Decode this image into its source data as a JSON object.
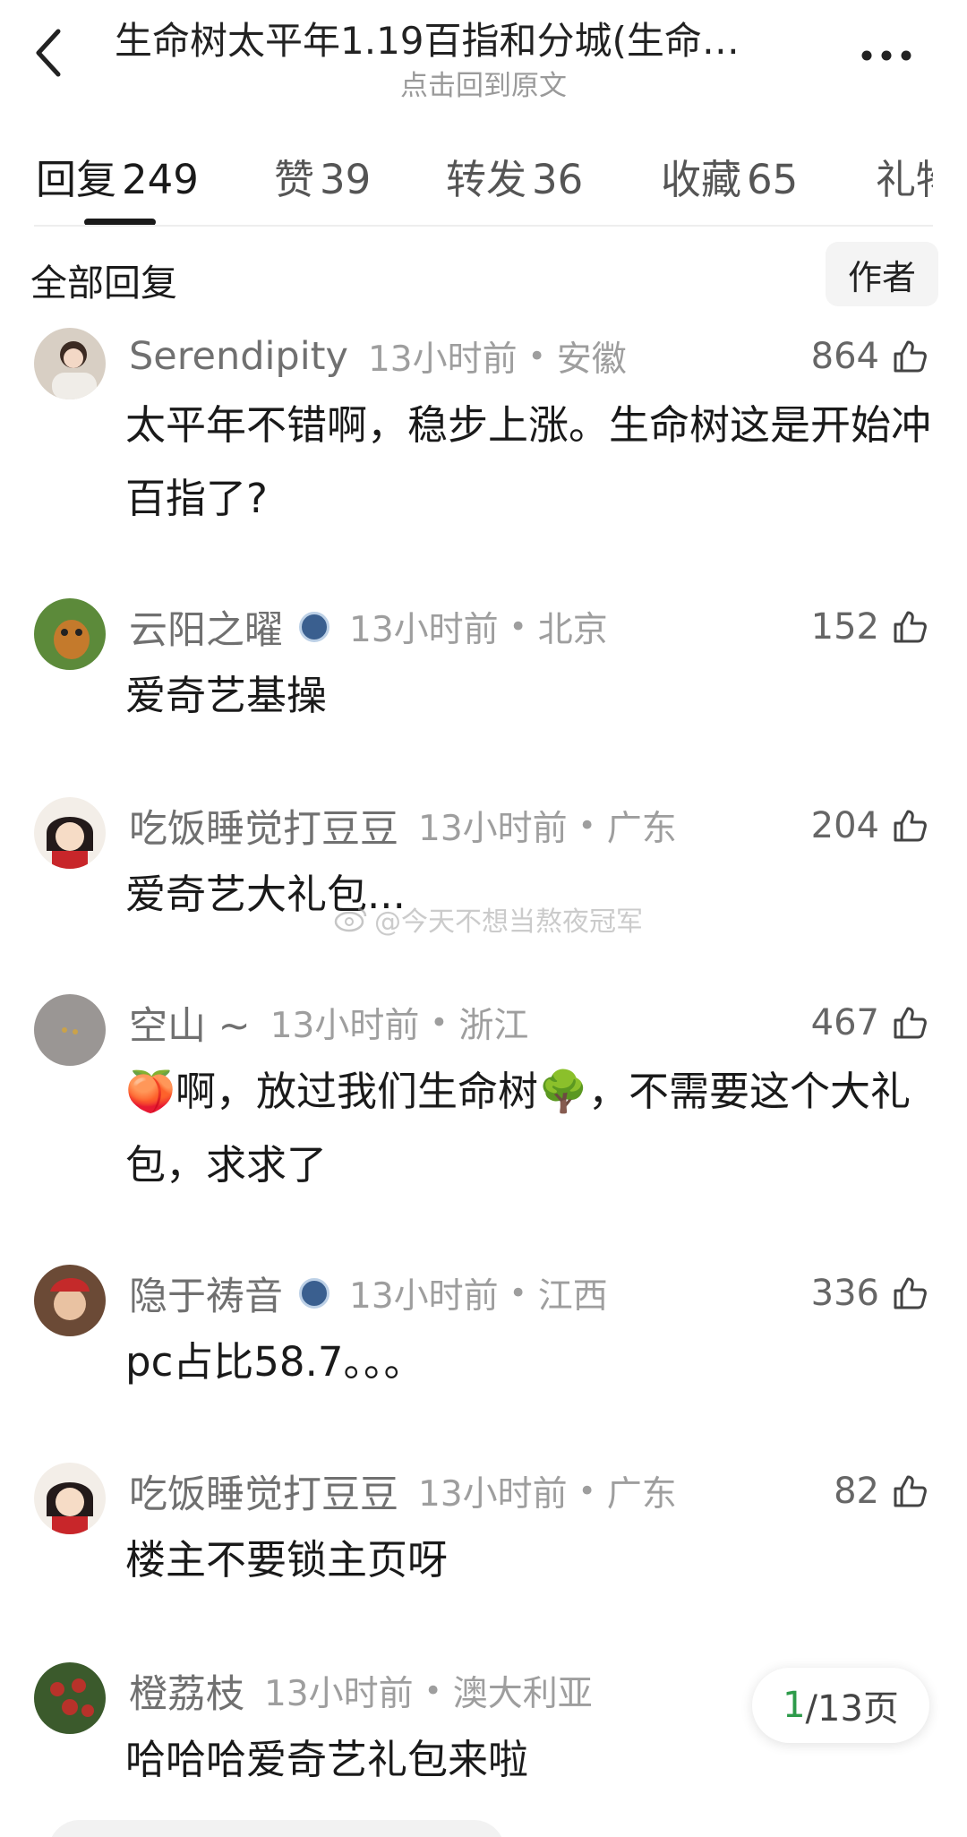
{
  "header": {
    "title": "生命树太平年1.19百指和分城(生命…",
    "subtitle": "点击回到原文"
  },
  "tabs": [
    {
      "label": "回复",
      "count": "249"
    },
    {
      "label": "赞",
      "count": "39"
    },
    {
      "label": "转发",
      "count": "36"
    },
    {
      "label": "收藏",
      "count": "65"
    },
    {
      "label": "礼物",
      "count": ""
    }
  ],
  "section": {
    "title": "全部回复",
    "author_filter": "作者"
  },
  "comments": [
    {
      "user": "Serendipity",
      "time": "13小时前",
      "sep": "•",
      "location": "安徽",
      "likes": "864",
      "text": "太平年不错啊，稳步上涨。生命树这是开始冲百指了?"
    },
    {
      "user": "云阳之曜",
      "time": "13小时前",
      "sep": "•",
      "location": "北京",
      "likes": "152",
      "text": "爱奇艺基操"
    },
    {
      "user": "吃饭睡觉打豆豆",
      "time": "13小时前",
      "sep": "•",
      "location": "广东",
      "likes": "204",
      "text": "爱奇艺大礼包..."
    },
    {
      "user": "空山 ~",
      "time": "13小时前",
      "sep": "•",
      "location": "浙江",
      "likes": "467",
      "text_a": "🍑啊，放过我们生命树",
      "text_b": "🌳，不需要这个大礼包，求求了"
    },
    {
      "user": "隐于祷音",
      "time": "13小时前",
      "sep": "•",
      "location": "江西",
      "likes": "336",
      "text": "pc占比58.7。。。"
    },
    {
      "user": "吃饭睡觉打豆豆",
      "time": "13小时前",
      "sep": "•",
      "location": "广东",
      "likes": "82",
      "text": "楼主不要锁主页呀"
    },
    {
      "user": "橙荔枝",
      "time": "13小时前",
      "sep": "•",
      "location": "澳大利亚",
      "likes": "",
      "text": "哈哈哈爱奇艺礼包来啦"
    }
  ],
  "watermark": "@今天不想当熬夜冠军",
  "pager": {
    "current": "1",
    "total_text": "/13页"
  },
  "colors": {
    "accent_green": "#2d9b4a",
    "meta_gray": "#9e9e9e"
  },
  "icons": [
    "back-arrow-icon",
    "more-dots-icon",
    "thumb-up-icon",
    "verified-badge-icon",
    "weibo-logo-icon"
  ]
}
